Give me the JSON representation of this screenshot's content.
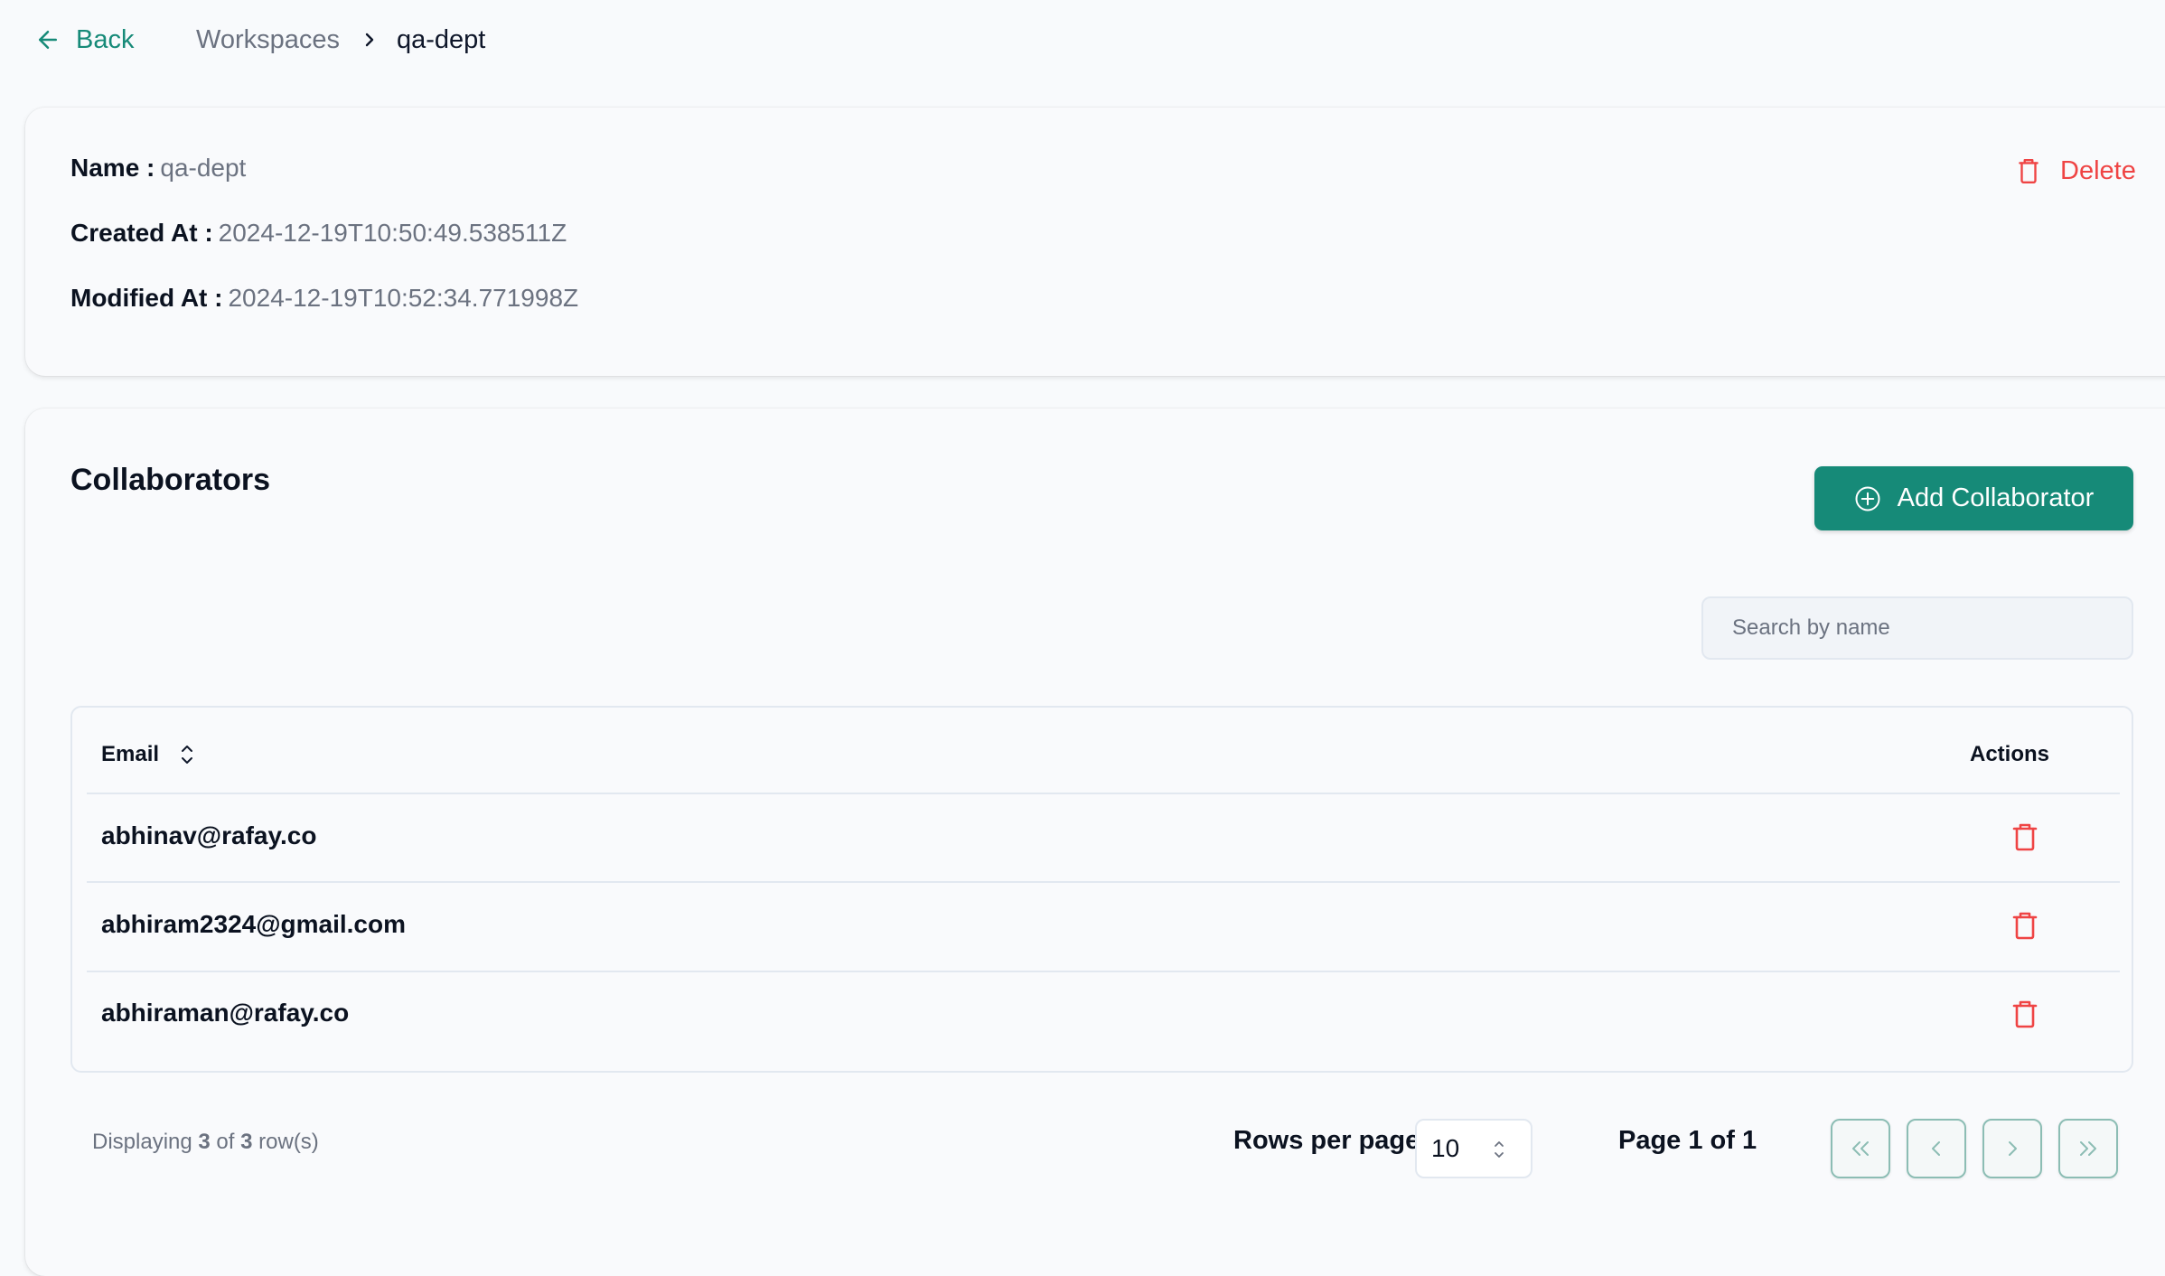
{
  "breadcrumb": {
    "back_label": "Back",
    "items": [
      "Workspaces",
      "qa-dept"
    ]
  },
  "details": {
    "name_label": "Name :",
    "name_value": "qa-dept",
    "created_label": "Created At :",
    "created_value": "2024-12-19T10:50:49.538511Z",
    "modified_label": "Modified At :",
    "modified_value": "2024-12-19T10:52:34.771998Z",
    "delete_label": "Delete"
  },
  "collaborators": {
    "title": "Collaborators",
    "add_button_label": "Add Collaborator",
    "search_placeholder": "Search by name",
    "search_value": "",
    "columns": [
      "Email",
      "Actions"
    ],
    "rows": [
      {
        "email": "abhinav@rafay.co"
      },
      {
        "email": "abhiram2324@gmail.com"
      },
      {
        "email": "abhiraman@rafay.co"
      }
    ]
  },
  "pagination": {
    "displaying_prefix": "Displaying",
    "displaying_shown": "3",
    "displaying_of": "of",
    "displaying_total": "3",
    "displaying_suffix": "row(s)",
    "rows_per_page_label": "Rows per page",
    "rows_per_page_value": "10",
    "page_label": "Page 1 of 1",
    "current_page": 1,
    "total_pages": 1
  },
  "icons": {
    "back": "arrow-left-icon",
    "breadcrumb_separator": "chevron-right-icon",
    "delete": "trash-icon",
    "add": "plus-circle-icon",
    "sort": "sort-icon",
    "row_delete": "trash-icon",
    "select": "chevron-up-down-icon",
    "first_page": "chevrons-left-icon",
    "prev_page": "chevron-left-icon",
    "next_page": "chevron-right-icon",
    "last_page": "chevrons-right-icon"
  },
  "colors": {
    "accent": "#168a78",
    "danger": "#ef4444",
    "background": "#f8fafc",
    "muted_text": "#6b7280"
  }
}
